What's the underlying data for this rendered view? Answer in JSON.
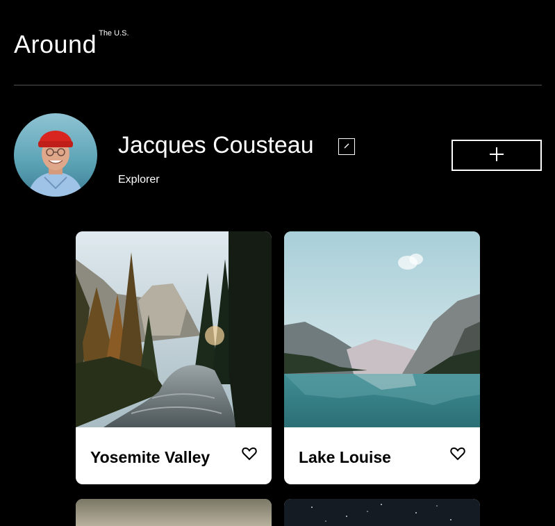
{
  "header": {
    "logo_main": "Around",
    "logo_sup": "The U.S."
  },
  "profile": {
    "name": "Jacques Cousteau",
    "role": "Explorer"
  },
  "cards": [
    {
      "title": "Yosemite Valley"
    },
    {
      "title": "Lake Louise"
    },
    {
      "title": ""
    },
    {
      "title": ""
    }
  ],
  "icons": {
    "edit": "pencil-icon",
    "add": "plus-icon",
    "like": "heart-icon"
  }
}
